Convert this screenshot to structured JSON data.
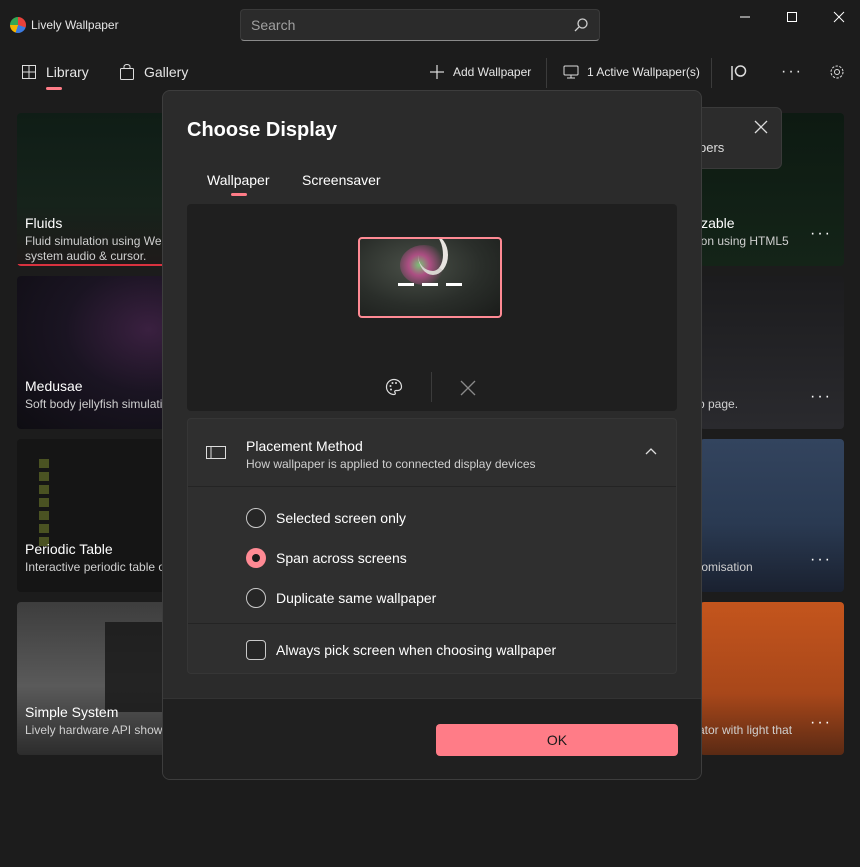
{
  "app": {
    "title": "Lively Wallpaper"
  },
  "search": {
    "placeholder": "Search"
  },
  "nav": {
    "library": "Library",
    "gallery": "Gallery"
  },
  "commands": {
    "add_wallpaper": "Add Wallpaper",
    "active_wallpapers": "1 Active Wallpaper(s)"
  },
  "cards": [
    {
      "title": "Fluids",
      "desc1": "Fluid simulation using Web",
      "desc2": "system audio & cursor."
    },
    {
      "title": "Medusae",
      "desc1": "Soft body jellyfish simulati"
    },
    {
      "title": "Periodic Table",
      "desc1": "Interactive periodic table o"
    },
    {
      "title": "Simple System",
      "desc1": "Lively hardware API showc"
    }
  ],
  "right_cards": [
    {
      "title": "izable",
      "desc": "ion using HTML5"
    },
    {
      "desc": "b page."
    },
    {
      "desc": "tomisation"
    },
    {
      "desc": "ator with light that"
    }
  ],
  "toast": {
    "text": "pers"
  },
  "dialog": {
    "title": "Choose Display",
    "tabs": {
      "wallpaper": "Wallpaper",
      "screensaver": "Screensaver"
    },
    "placement": {
      "title": "Placement Method",
      "subtitle": "How wallpaper is applied to connected display devices",
      "options": [
        "Selected screen only",
        "Span across screens",
        "Duplicate same wallpaper"
      ],
      "selected_index": 1
    },
    "always_pick": {
      "label": "Always pick screen when choosing wallpaper",
      "checked": false
    },
    "ok_label": "OK"
  },
  "colors": {
    "accent": "#ff7c87",
    "background": "#1c1c1c",
    "dialog_bg": "#2b2b2b"
  }
}
